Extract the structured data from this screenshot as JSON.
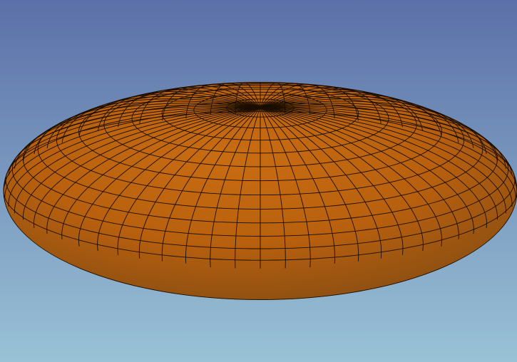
{
  "viewport": {
    "background_top": "#5b70a8",
    "background_bottom": "#99c2d6",
    "model": {
      "shape": "oblate-ellipsoid-mesh",
      "fill_color": "#b8600e",
      "fill_highlight": "#c96d12",
      "fill_shadow": "#8a4e12",
      "edge_color": "#1a0d00",
      "latitude_divisions": 24,
      "longitude_divisions": 64
    }
  }
}
